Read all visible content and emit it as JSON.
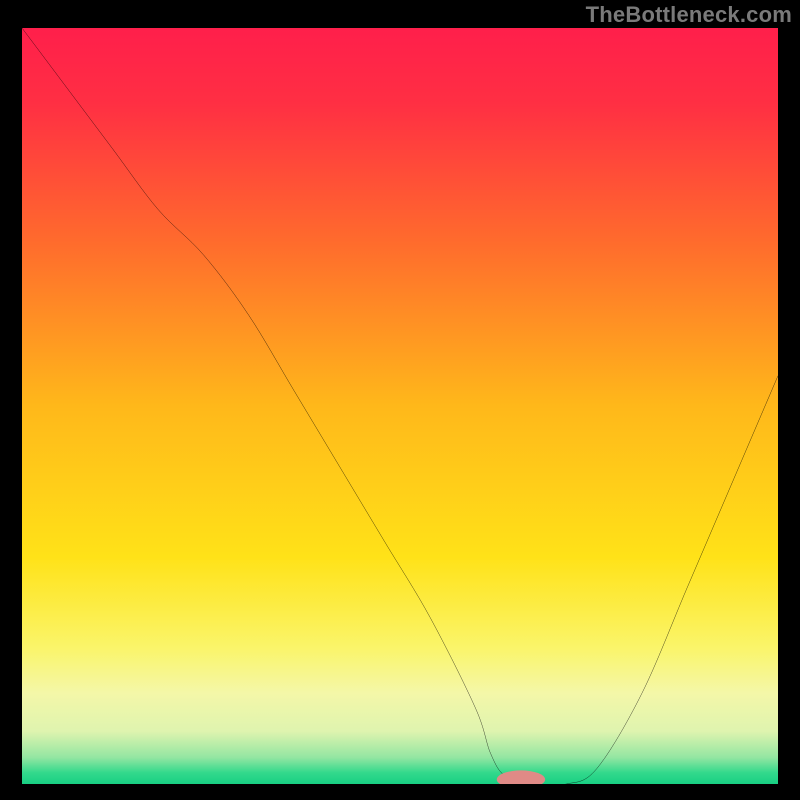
{
  "watermark": "TheBottleneck.com",
  "chart_data": {
    "type": "line",
    "title": "",
    "xlabel": "",
    "ylabel": "",
    "xlim": [
      0,
      100
    ],
    "ylim": [
      0,
      100
    ],
    "grid": false,
    "background_gradient_stops": [
      {
        "offset": 0.0,
        "color": "#ff1f4b"
      },
      {
        "offset": 0.1,
        "color": "#ff2f43"
      },
      {
        "offset": 0.28,
        "color": "#ff6a2d"
      },
      {
        "offset": 0.5,
        "color": "#ffb81a"
      },
      {
        "offset": 0.7,
        "color": "#ffe218"
      },
      {
        "offset": 0.82,
        "color": "#faf56a"
      },
      {
        "offset": 0.88,
        "color": "#f4f7a8"
      },
      {
        "offset": 0.93,
        "color": "#dff4af"
      },
      {
        "offset": 0.965,
        "color": "#93e6a2"
      },
      {
        "offset": 0.985,
        "color": "#33d98c"
      },
      {
        "offset": 1.0,
        "color": "#18cf83"
      }
    ],
    "series": [
      {
        "name": "bottleneck-curve",
        "color": "#000000",
        "x": [
          0,
          6,
          12,
          18,
          24,
          30,
          36,
          42,
          48,
          54,
          60,
          62,
          64,
          68,
          72,
          76,
          82,
          88,
          94,
          100
        ],
        "values": [
          100,
          92,
          84,
          76,
          70,
          62,
          52,
          42,
          32,
          22,
          10,
          4,
          1,
          0,
          0,
          2,
          12,
          26,
          40,
          54
        ]
      }
    ],
    "marker": {
      "name": "optimal-range-marker",
      "x": 66,
      "y": 0.6,
      "rx": 3.2,
      "ry": 1.2,
      "color": "#e08a86"
    }
  }
}
